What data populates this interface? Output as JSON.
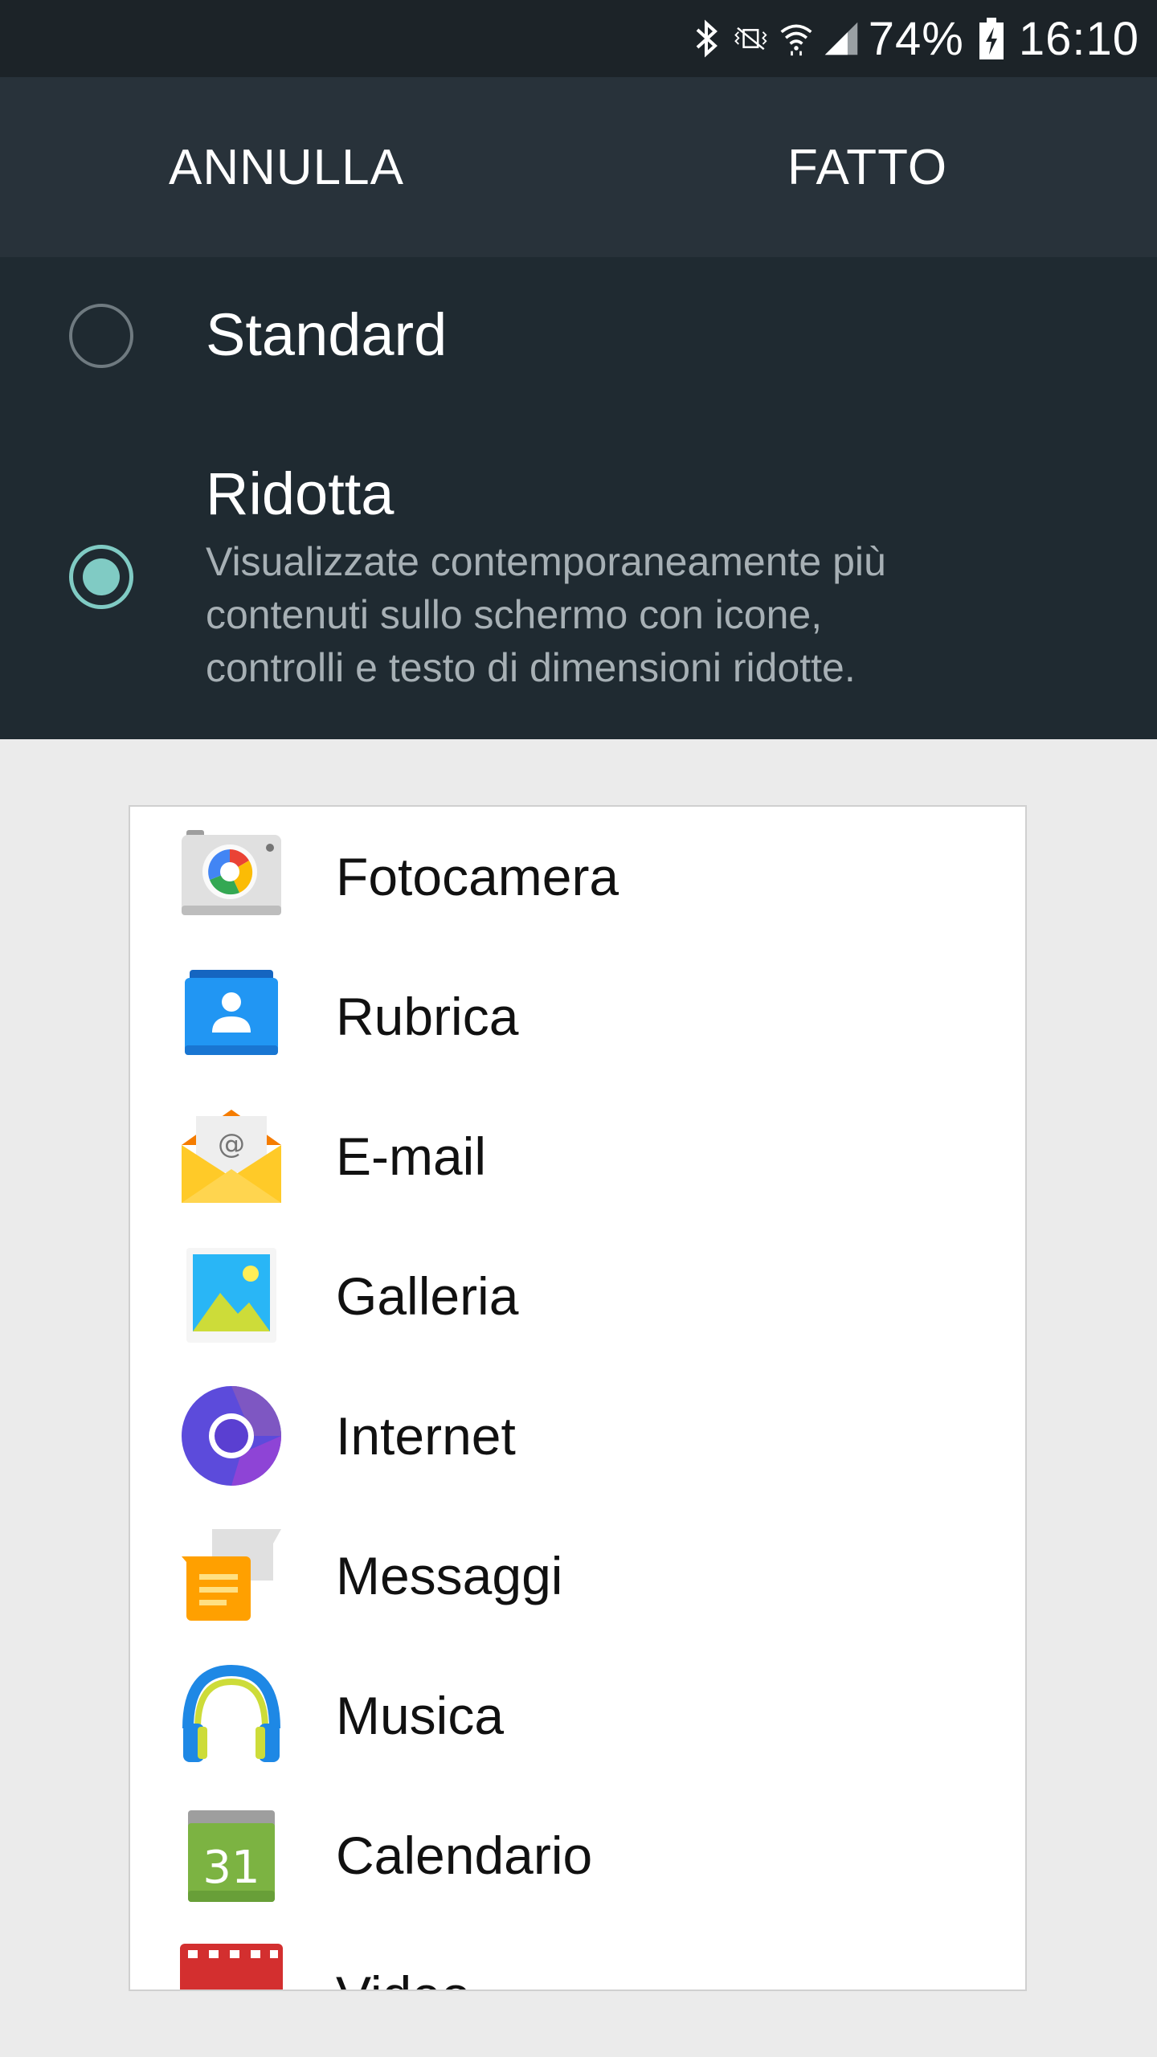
{
  "status_bar": {
    "battery": "74%",
    "time": "16:10",
    "icons": [
      "bluetooth-icon",
      "vibrate-mute-icon",
      "wifi-icon",
      "signal-icon",
      "battery-charging-icon"
    ]
  },
  "action_bar": {
    "cancel_label": "ANNULLA",
    "done_label": "FATTO"
  },
  "options": {
    "standard": {
      "label": "Standard",
      "selected": false
    },
    "reduced": {
      "label": "Ridotta",
      "selected": true,
      "description_lines": [
        "Visualizzate contemporaneamente più",
        "contenuti sullo schermo con icone,",
        "controlli e testo di dimensioni ridotte."
      ]
    }
  },
  "apps": [
    {
      "label": "Fotocamera",
      "icon": "camera-icon"
    },
    {
      "label": "Rubrica",
      "icon": "contacts-icon"
    },
    {
      "label": "E-mail",
      "icon": "email-icon"
    },
    {
      "label": "Galleria",
      "icon": "gallery-icon"
    },
    {
      "label": "Internet",
      "icon": "internet-icon"
    },
    {
      "label": "Messaggi",
      "icon": "messages-icon"
    },
    {
      "label": "Musica",
      "icon": "music-icon"
    },
    {
      "label": "Calendario",
      "icon": "calendar-icon",
      "icon_text": "31"
    },
    {
      "label": "Video",
      "icon": "video-icon"
    }
  ],
  "colors": {
    "statusbar_bg": "#1c2328",
    "actionbar_bg": "#28323a",
    "options_bg": "#1f2a31",
    "accent": "#80cbc4"
  }
}
